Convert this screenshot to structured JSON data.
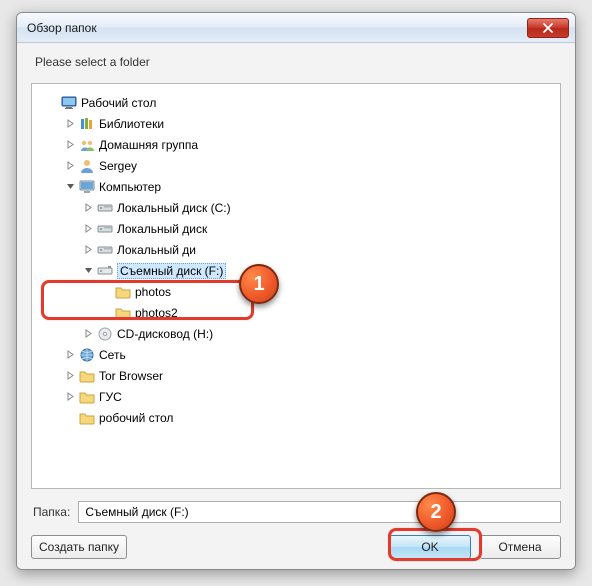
{
  "window": {
    "title": "Обзор папок",
    "instruction": "Please select a folder"
  },
  "tree": {
    "items": [
      {
        "indent": 0,
        "exp": "none",
        "icon": "desktop",
        "label": "Рабочий стол"
      },
      {
        "indent": 1,
        "exp": "closed",
        "icon": "library",
        "label": "Библиотеки"
      },
      {
        "indent": 1,
        "exp": "closed",
        "icon": "homegroup",
        "label": "Домашняя группа"
      },
      {
        "indent": 1,
        "exp": "closed",
        "icon": "user",
        "label": "Sergey"
      },
      {
        "indent": 1,
        "exp": "open",
        "icon": "computer",
        "label": "Компьютер"
      },
      {
        "indent": 2,
        "exp": "closed",
        "icon": "hdd",
        "label": "Локальный диск (C:)"
      },
      {
        "indent": 2,
        "exp": "closed",
        "icon": "hdd",
        "label": "Локальный диск"
      },
      {
        "indent": 2,
        "exp": "closed",
        "icon": "hdd",
        "label": "Локальный ди"
      },
      {
        "indent": 2,
        "exp": "open",
        "icon": "removable",
        "label": "Съемный диск (F:)",
        "selected": true
      },
      {
        "indent": 3,
        "exp": "none",
        "icon": "folder",
        "label": "photos"
      },
      {
        "indent": 3,
        "exp": "none",
        "icon": "folder",
        "label": "photos2"
      },
      {
        "indent": 2,
        "exp": "closed",
        "icon": "cd",
        "label": "CD-дисковод (H:)"
      },
      {
        "indent": 1,
        "exp": "closed",
        "icon": "network",
        "label": "Сеть"
      },
      {
        "indent": 1,
        "exp": "closed",
        "icon": "folder",
        "label": "Tor Browser"
      },
      {
        "indent": 1,
        "exp": "closed",
        "icon": "folder",
        "label": "ГУС"
      },
      {
        "indent": 1,
        "exp": "none",
        "icon": "folder",
        "label": "робочий стол"
      }
    ]
  },
  "path": {
    "label": "Папка:",
    "value": "Съемный диск (F:)"
  },
  "buttons": {
    "make_folder": "Создать папку",
    "ok": "OK",
    "cancel": "Отмена"
  },
  "annotations": {
    "badge1": "1",
    "badge2": "2"
  }
}
